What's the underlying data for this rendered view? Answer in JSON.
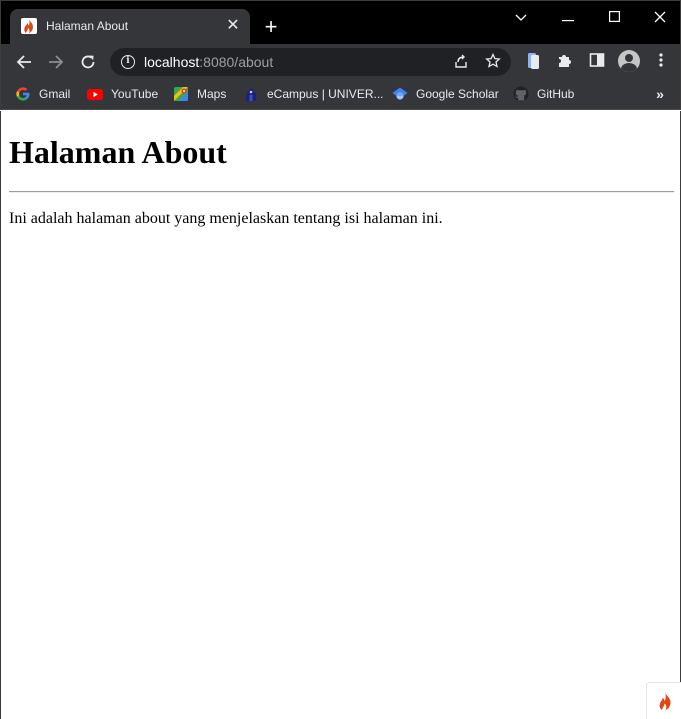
{
  "browser": {
    "tab": {
      "title": "Halaman About",
      "close_glyph": "✕"
    },
    "new_tab_glyph": "+",
    "window_controls": {
      "list_tabs_glyph": "⌄",
      "minimize_glyph": "—",
      "maximize_glyph": "☐",
      "close_glyph": "✕"
    },
    "nav": {
      "back_glyph": "←",
      "forward_glyph": "→",
      "reload_glyph": "↻"
    },
    "address": {
      "host": "localhost",
      "rest": ":8080/about"
    },
    "omnibox_icons": [
      "share-icon",
      "star-icon"
    ],
    "toolbar_icons": [
      "reading-list-icon",
      "extensions-icon",
      "side-panel-icon",
      "profile-avatar",
      "kebab-menu-icon"
    ],
    "bookmarks": [
      {
        "label": "Gmail",
        "icon": "google-icon"
      },
      {
        "label": "YouTube",
        "icon": "youtube-icon"
      },
      {
        "label": "Maps",
        "icon": "maps-icon"
      },
      {
        "label": "eCampus | UNIVER...",
        "icon": "ecampus-icon"
      },
      {
        "label": "Google Scholar",
        "icon": "google-scholar-icon"
      },
      {
        "label": "GitHub",
        "icon": "github-icon"
      }
    ],
    "bookmarks_more_glyph": "»",
    "colors": {
      "titlebar": "#000000",
      "toolbar": "#35363a",
      "omnibox": "#202124",
      "text_light": "#e8eaed",
      "url_dim": "#9aa0a6"
    }
  },
  "page": {
    "heading": "Halaman About",
    "body_text": "Ini adalah halaman about yang menjelaskan tentang isi halaman ini.",
    "debug_toolbar_icon": "codeigniter-flame-icon"
  }
}
